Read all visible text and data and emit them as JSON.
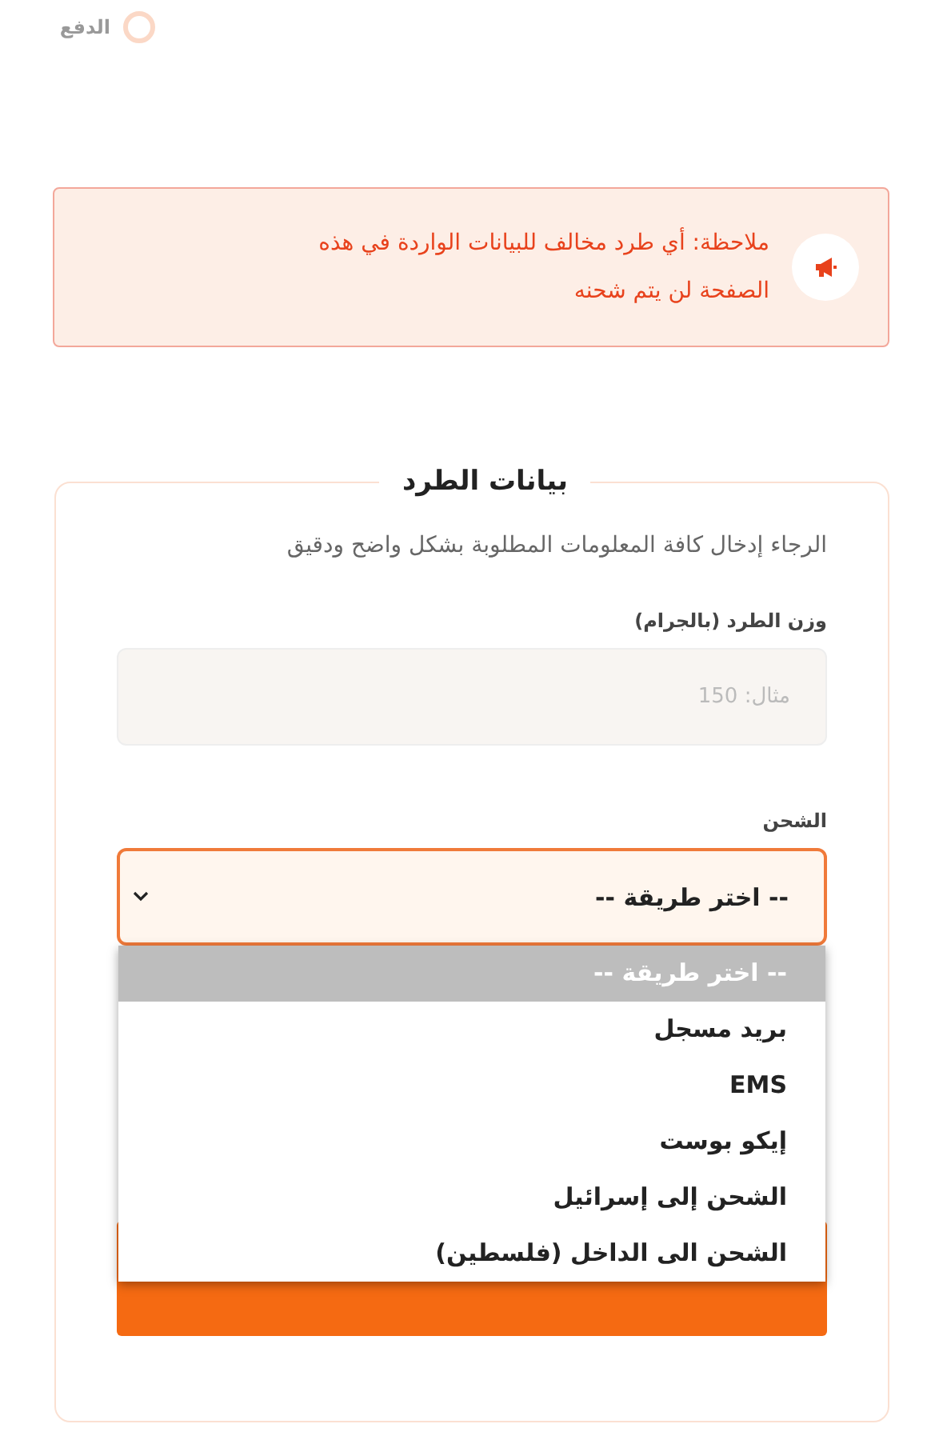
{
  "step": {
    "label": "الدفع"
  },
  "notice": {
    "text": "ملاحظة: أي طرد مخالف للبيانات الواردة في هذه الصفحة لن يتم شحنه"
  },
  "section": {
    "title": "بيانات الطرد",
    "description": "الرجاء إدخال كافة المعلومات المطلوبة بشكل واضح ودقيق",
    "weight": {
      "label": "وزن الطرد (بالجرام)",
      "placeholder": "مثال: 150"
    },
    "shipping": {
      "label": "الشحن",
      "value": "-- اختر طريقة --",
      "expanded": true,
      "options": [
        {
          "label": "-- اختر طريقة --",
          "selected": true
        },
        {
          "label": "بريد مسجل",
          "selected": false
        },
        {
          "label": "EMS",
          "selected": false
        },
        {
          "label": "إيكو بوست",
          "selected": false
        },
        {
          "label": "الشحن إلى إسرائيل",
          "selected": false
        },
        {
          "label": "الشحن الى الداخل (فلسطين)",
          "selected": false
        }
      ]
    }
  }
}
